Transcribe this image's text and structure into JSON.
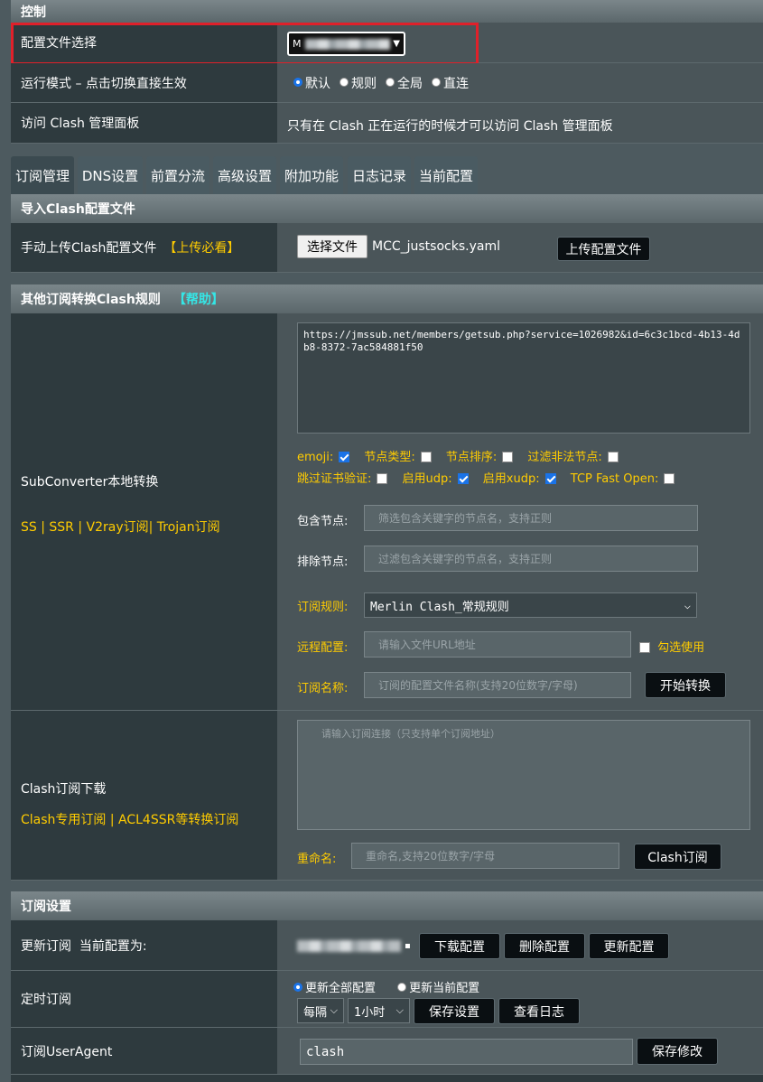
{
  "control": {
    "title": "控制",
    "config_select_label": "配置文件选择",
    "run_mode_label": "运行模式 – 点击切换直接生效",
    "run_modes": [
      "默认",
      "规则",
      "全局",
      "直连"
    ],
    "dashboard_label": "访问 Clash 管理面板",
    "dashboard_note": "只有在 Clash 正在运行的时候才可以访问 Clash 管理面板"
  },
  "tabs": [
    "订阅管理",
    "DNS设置",
    "前置分流",
    "高级设置",
    "附加功能",
    "日志记录",
    "当前配置"
  ],
  "import": {
    "title": "导入Clash配置文件",
    "upload_label": "手动上传Clash配置文件",
    "upload_hint": "【上传必看】",
    "choose_file": "选择文件",
    "file_name": "MCC_justsocks.yaml",
    "upload_button": "上传配置文件"
  },
  "convert": {
    "title": "其他订阅转换Clash规则",
    "help": "【帮助】",
    "left_title": "SubConverter本地转换",
    "left_sub": "SS | SSR | V2ray订阅| Trojan订阅",
    "url_value": "https://jmssub.net/members/getsub.php?service=1026982&id=6c3c1bcd-4b13-4db8-8372-7ac584881f50",
    "options_row1": [
      {
        "label": "emoji:",
        "checked": true
      },
      {
        "label": "节点类型:",
        "checked": false
      },
      {
        "label": "节点排序:",
        "checked": false
      },
      {
        "label": "过滤非法节点:",
        "checked": false
      }
    ],
    "options_row2": [
      {
        "label": "跳过证书验证:",
        "checked": false
      },
      {
        "label": "启用udp:",
        "checked": true
      },
      {
        "label": "启用xudp:",
        "checked": true
      },
      {
        "label": "TCP Fast Open:",
        "checked": false
      }
    ],
    "include_label": "包含节点:",
    "include_placeholder": "筛选包含关键字的节点名，支持正则",
    "exclude_label": "排除节点:",
    "exclude_placeholder": "过滤包含关键字的节点名，支持正则",
    "rule_label": "订阅规则:",
    "rule_value": "Merlin Clash_常规规则",
    "remote_label": "远程配置:",
    "remote_placeholder": "请输入文件URL地址",
    "remote_use": "勾选使用",
    "name_label": "订阅名称:",
    "name_placeholder": "订阅的配置文件名称(支持20位数字/字母)",
    "start_button": "开始转换"
  },
  "download": {
    "left_title": "Clash订阅下载",
    "left_sub": "Clash专用订阅 | ACL4SSR等转换订阅",
    "url_placeholder": "请输入订阅连接（只支持单个订阅地址）",
    "rename_label": "重命名:",
    "rename_placeholder": "重命名,支持20位数字/字母",
    "button": "Clash订阅"
  },
  "sub_settings": {
    "title": "订阅设置",
    "update_label": "更新订阅  当前配置为:",
    "download_btn": "下载配置",
    "delete_btn": "删除配置",
    "update_btn": "更新配置",
    "timer_label": "定时订阅",
    "timer_options": [
      "更新全部配置",
      "更新当前配置"
    ],
    "interval_value": "每隔",
    "hours_value": "1小时",
    "save_btn": "保存设置",
    "log_btn": "查看日志",
    "ua_label": "订阅UserAgent",
    "ua_value": "clash",
    "ua_save": "保存修改"
  },
  "colors": {
    "highlight_box": "#e0202a",
    "accent_yellow": "#ffcc00",
    "accent_cyan": "#35e6e6"
  }
}
